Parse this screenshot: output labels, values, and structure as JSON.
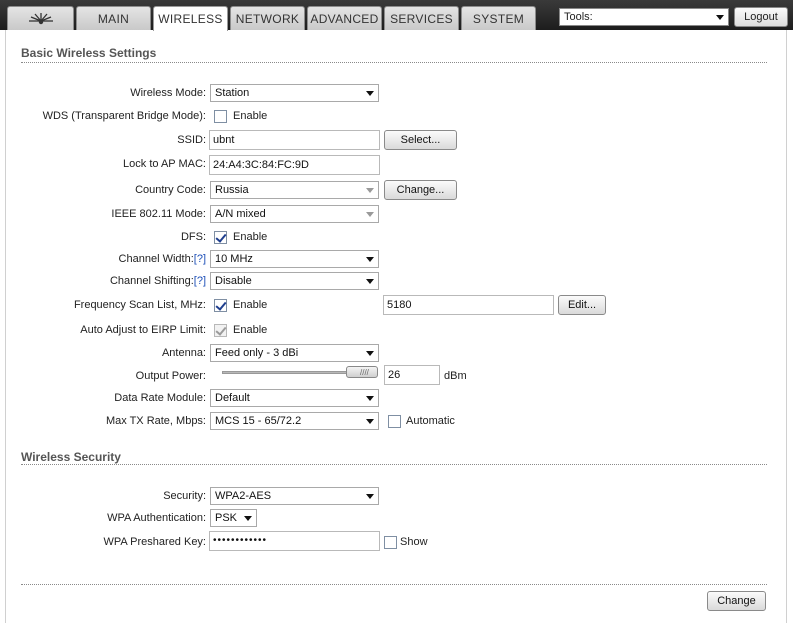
{
  "tabs": {
    "logo": "ubiquiti-logo-icon",
    "main": "MAIN",
    "wireless": "WIRELESS",
    "network": "NETWORK",
    "advanced": "ADVANCED",
    "services": "SERVICES",
    "system": "SYSTEM"
  },
  "header": {
    "tools_value": "Tools:",
    "logout_label": "Logout"
  },
  "basic": {
    "title": "Basic Wireless Settings",
    "wireless_mode": {
      "label": "Wireless Mode:",
      "value": "Station"
    },
    "wds": {
      "label": "WDS (Transparent Bridge Mode):",
      "checkbox_label": "Enable",
      "checked": false
    },
    "ssid": {
      "label": "SSID:",
      "value": "ubnt",
      "button": "Select..."
    },
    "lock_ap": {
      "label": "Lock to AP MAC:",
      "value": "24:A4:3C:84:FC:9D"
    },
    "country": {
      "label": "Country Code:",
      "value": "Russia",
      "button": "Change..."
    },
    "ieee_mode": {
      "label": "IEEE 802.11 Mode:",
      "value": "A/N mixed"
    },
    "dfs": {
      "label": "DFS:",
      "checkbox_label": "Enable",
      "checked": true
    },
    "channel_width": {
      "label": "Channel Width:",
      "help": "[?]",
      "value": "10 MHz"
    },
    "channel_shifting": {
      "label": "Channel Shifting:",
      "help": "[?]",
      "value": "Disable"
    },
    "freq_scan": {
      "label": "Frequency Scan List, MHz:",
      "checkbox_label": "Enable",
      "checked": true,
      "value": "5180",
      "button": "Edit..."
    },
    "auto_eirp": {
      "label": "Auto Adjust to EIRP Limit:",
      "checkbox_label": "Enable",
      "checked": true
    },
    "antenna": {
      "label": "Antenna:",
      "value": "Feed only - 3 dBi"
    },
    "output_power": {
      "label": "Output Power:",
      "value": "26",
      "unit": "dBm",
      "slider_level_dbm": 26
    },
    "data_rate_module": {
      "label": "Data Rate Module:",
      "value": "Default"
    },
    "max_tx_rate": {
      "label": "Max TX Rate, Mbps:",
      "value": "MCS 15 - 65/72.2",
      "checkbox_label": "Automatic",
      "checked": false
    }
  },
  "security": {
    "title": "Wireless Security",
    "security": {
      "label": "Security:",
      "value": "WPA2-AES"
    },
    "wpa_auth": {
      "label": "WPA Authentication:",
      "value": "PSK"
    },
    "wpa_key": {
      "label": "WPA Preshared Key:",
      "value": "••••••••••••",
      "checkbox_label": "Show",
      "checked": false
    }
  },
  "footer": {
    "change_label": "Change"
  }
}
